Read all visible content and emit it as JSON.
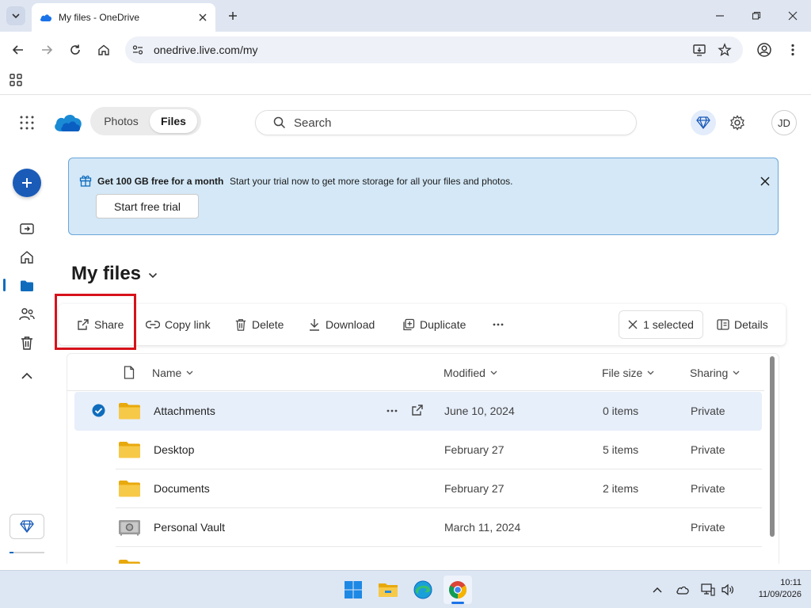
{
  "browser": {
    "tab_title": "My files - OneDrive",
    "url": "onedrive.live.com/my"
  },
  "header": {
    "switcher": [
      "Photos",
      "Files"
    ],
    "active_view": "Files",
    "search_placeholder": "Search",
    "avatar_initials": "JD"
  },
  "banner": {
    "title": "Get 100 GB free for a month",
    "message": "Start your trial now to get more storage for all your files and photos.",
    "cta": "Start free trial"
  },
  "page": {
    "title": "My files"
  },
  "commands": {
    "share": "Share",
    "copy_link": "Copy link",
    "delete": "Delete",
    "download": "Download",
    "duplicate": "Duplicate",
    "selected": "1 selected",
    "details": "Details"
  },
  "table": {
    "columns": [
      "Name",
      "Modified",
      "File size",
      "Sharing"
    ],
    "rows": [
      {
        "name": "Attachments",
        "modified": "June 10, 2024",
        "size": "0 items",
        "sharing": "Private",
        "type": "folder",
        "selected": true
      },
      {
        "name": "Desktop",
        "modified": "February 27",
        "size": "5 items",
        "sharing": "Private",
        "type": "folder",
        "selected": false
      },
      {
        "name": "Documents",
        "modified": "February 27",
        "size": "2 items",
        "sharing": "Private",
        "type": "folder",
        "selected": false
      },
      {
        "name": "Personal Vault",
        "modified": "March 11, 2024",
        "size": "",
        "sharing": "Private",
        "type": "vault",
        "selected": false
      }
    ]
  },
  "taskbar": {
    "time": "10:11",
    "date": "11/09/2026",
    "apps": [
      "start-icon",
      "file-explorer-icon",
      "edge-icon",
      "chrome-icon"
    ]
  },
  "colors": {
    "accent": "#0f6cbd",
    "banner_bg": "#d4e8f7",
    "highlight_box": "#d7121b",
    "folder": "#f4c542"
  }
}
